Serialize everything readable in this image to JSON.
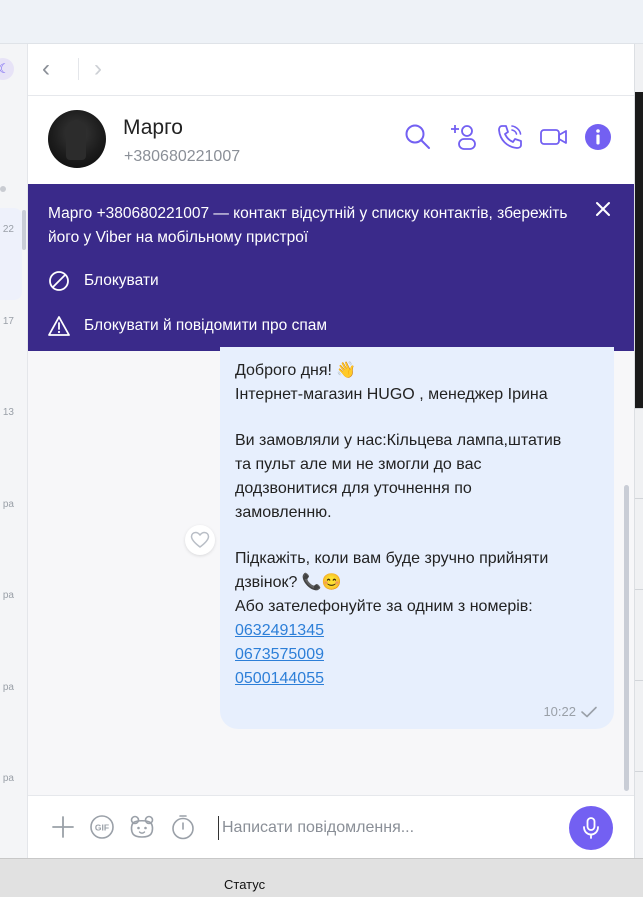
{
  "sidebar": {
    "logo_glyph": "☾",
    "timestamps": [
      "22",
      "17",
      "13",
      "pa",
      "pa",
      "pa",
      "pa"
    ]
  },
  "nav": {
    "back_icon": "chevron-left-icon",
    "back_glyph": "‹",
    "forward_icon": "chevron-right-icon",
    "forward_glyph": "›"
  },
  "header": {
    "name": "Марго",
    "phone": "+380680221007",
    "icons": [
      "search-icon",
      "add-participant-icon",
      "voice-call-icon",
      "video-call-icon",
      "info-icon"
    ]
  },
  "banner": {
    "text": "Марго +380680221007 — контакт відсутній у списку контактів, збережіть його у Viber на мобільному пристрої",
    "block_label": "Блокувати",
    "block_report_label": "Блокувати й повідомити про спам"
  },
  "message": {
    "greeting": "Доброго дня! 👋",
    "intro": "Інтернет-магазин HUGO , менеджер Ірина",
    "body_lines": [
      "Ви замовляли у нас:Кільцева лампа,штатив",
      "та пульт   але ми не змогли до вас",
      "додзвонитися для уточнення по",
      "замовленню."
    ],
    "ask_lines": [
      "Підкажіть, коли вам буде зручно прийняти",
      "дзвінок? 📞😊",
      "Або зателефонуйте за одним з номерів:"
    ],
    "phones": [
      "0632491345",
      "0673575009",
      "0500144055"
    ],
    "time": "10:22"
  },
  "composer": {
    "placeholder": "Написати повідомлення...",
    "icons": [
      "plus-icon",
      "gif-icon",
      "sticker-icon",
      "timer-icon",
      "microphone-icon"
    ]
  },
  "status_bar": {
    "label": "Статус"
  },
  "colors": {
    "accent": "#7360f2",
    "banner": "#3a2a8a",
    "bubble": "#e7effd",
    "link": "#2d7fd8"
  }
}
